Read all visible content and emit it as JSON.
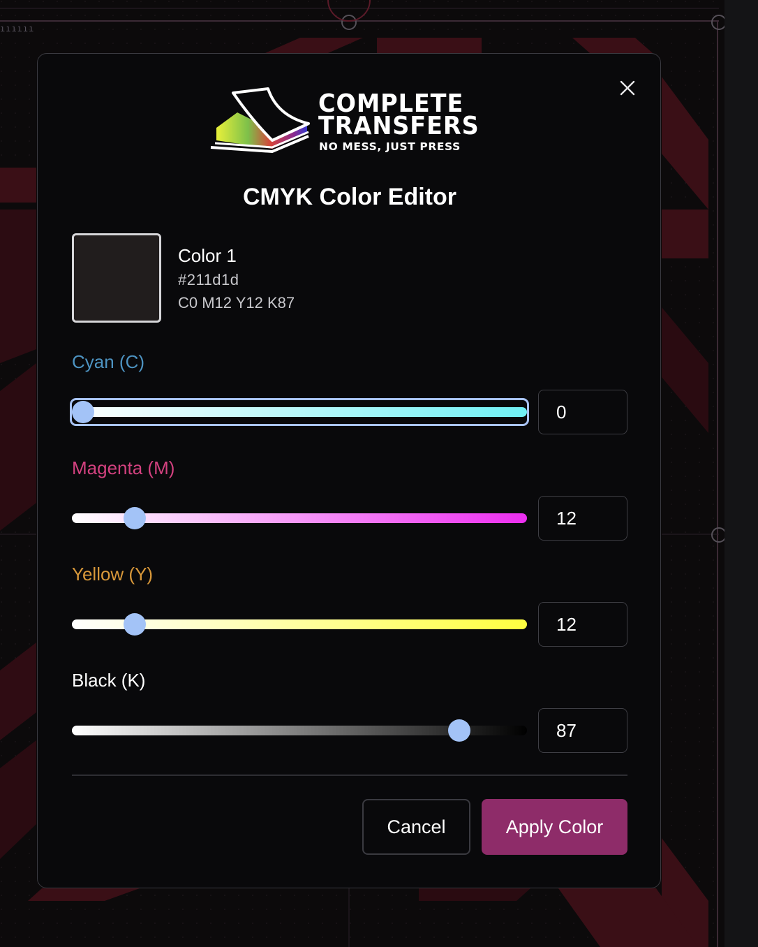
{
  "brand": {
    "line1": "COMPLETE",
    "line2": "TRANSFERS",
    "tagline": "NO MESS, JUST PRESS",
    "logo_icon": "stacked-transfer-sheets-icon"
  },
  "dialog": {
    "title": "CMYK Color Editor",
    "close_icon": "close-icon"
  },
  "color": {
    "name": "Color 1",
    "hex": "#211d1d",
    "cmyk_text": "C0 M12 Y12 K87",
    "swatch_hex": "#211d1d"
  },
  "channels": [
    {
      "label": "Cyan (C)",
      "value": 0,
      "color": "#4d93c1",
      "track_end": "#6ff0f4",
      "focused": true
    },
    {
      "label": "Magenta (M)",
      "value": 12,
      "color": "#d2417f",
      "track_end": "#ec2ef0",
      "focused": false
    },
    {
      "label": "Yellow (Y)",
      "value": 12,
      "color": "#d8983a",
      "track_end": "#ffff40",
      "focused": false
    },
    {
      "label": "Black (K)",
      "value": 87,
      "color": "#ffffff",
      "track_end": "#000000",
      "focused": false
    }
  ],
  "slider_max": 100,
  "actions": {
    "cancel": "Cancel",
    "apply": "Apply Color"
  },
  "colors": {
    "accent": "#8e2c69",
    "thumb": "#a3c3f7",
    "modal_bg": "#09090b"
  }
}
